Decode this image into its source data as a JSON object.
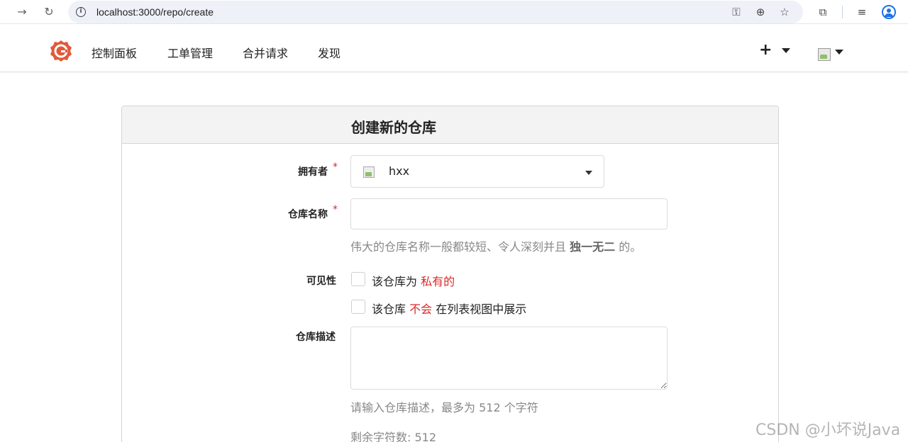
{
  "browser": {
    "url": "localhost:3000/repo/create"
  },
  "header": {
    "nav": [
      "控制面板",
      "工单管理",
      "合并请求",
      "发现"
    ],
    "plus_label": "+"
  },
  "form": {
    "title": "创建新的仓库",
    "owner_label": "拥有者",
    "required_mark": "*",
    "owner_value": "hxx",
    "repo_name_label": "仓库名称",
    "repo_name_value": "",
    "repo_name_help_prefix": "伟大的仓库名称一般都较短、令人深刻并且",
    "repo_name_help_bold": "独一无二",
    "repo_name_help_suffix": "的。",
    "visibility_label": "可见性",
    "private_prefix": "该仓库为",
    "private_highlight": "私有的",
    "private_checked": false,
    "unlisted_prefix": "该仓库",
    "unlisted_highlight": "不会",
    "unlisted_suffix": "在列表视图中展示",
    "unlisted_checked": false,
    "description_label": "仓库描述",
    "description_value": "",
    "description_help": "请输入仓库描述，最多为 512 个字符",
    "remaining_chars": "剩余字符数: 512"
  },
  "watermark": "CSDN @小坏说Java",
  "colors": {
    "accent_red": "#db2828",
    "logo": "#e05a3a"
  }
}
